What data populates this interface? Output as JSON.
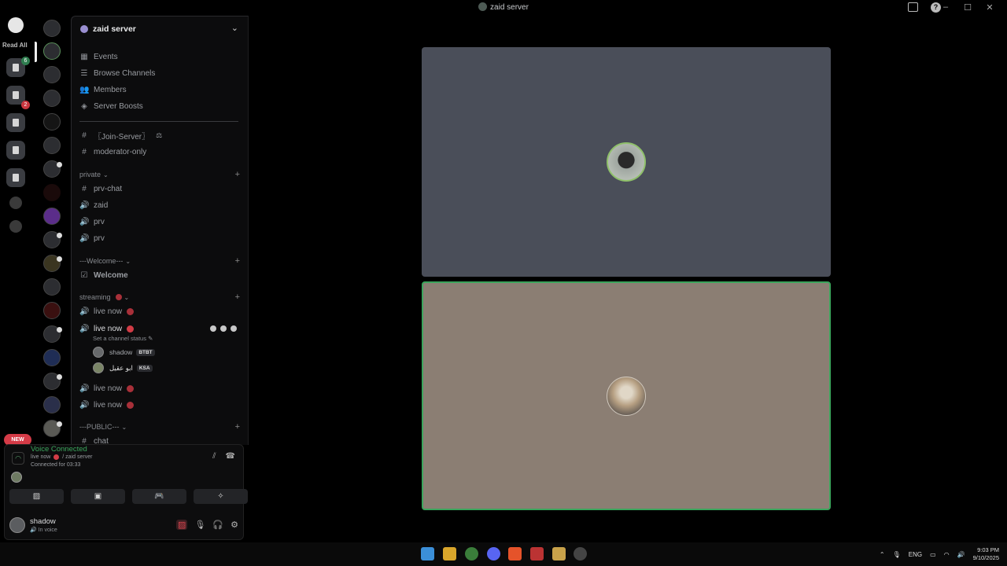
{
  "window": {
    "title": "zaid server",
    "controls": [
      "–",
      "☐",
      "✕"
    ]
  },
  "rail": {
    "read_all": "Read All",
    "badges": [
      "6",
      "2"
    ],
    "new_label": "NEW"
  },
  "server": {
    "name": "zaid server"
  },
  "menu": [
    {
      "label": "Events",
      "icon": "calendar-icon"
    },
    {
      "label": "Browse Channels",
      "icon": "browse-icon"
    },
    {
      "label": "Members",
      "icon": "members-icon"
    },
    {
      "label": "Server Boosts",
      "icon": "boost-icon"
    }
  ],
  "top_channels": [
    {
      "label": "〖Join-Server〗",
      "type": "text"
    },
    {
      "label": "moderator-only",
      "type": "text"
    }
  ],
  "categories": {
    "private": "private",
    "welcome": "---Welcome---",
    "streaming": "streaming",
    "public": "---PUBLIC---"
  },
  "private_channels": [
    {
      "label": "prv-chat",
      "type": "text"
    },
    {
      "label": "zaid",
      "type": "voice"
    },
    {
      "label": "prv",
      "type": "voice"
    },
    {
      "label": "prv",
      "type": "voice"
    }
  ],
  "welcome_channel": "Welcome",
  "streaming_channels": {
    "first": "live now",
    "active": "live now",
    "status_placeholder": "Set a channel status",
    "members": [
      {
        "name": "shadow",
        "tag": "BTBT"
      },
      {
        "name": "ابو عقيل",
        "tag": "KSA"
      }
    ],
    "after": [
      "live now",
      "live now"
    ]
  },
  "public_channels": [
    "chat"
  ],
  "voice_panel": {
    "status": "Voice Connected",
    "channel": "live now",
    "server": "/ zaid server",
    "connected_for": "Connected for 03:33"
  },
  "user": {
    "name": "shadow",
    "status": "In voice"
  },
  "taskbar": {
    "lang": "ENG",
    "time": "9:03 PM",
    "date": "9/10/2025"
  },
  "colors": {
    "connected_green": "#3ba55c",
    "live_red": "#d23c46",
    "tile_top": "#4a4e59",
    "tile_bottom": "#8b7e73"
  }
}
